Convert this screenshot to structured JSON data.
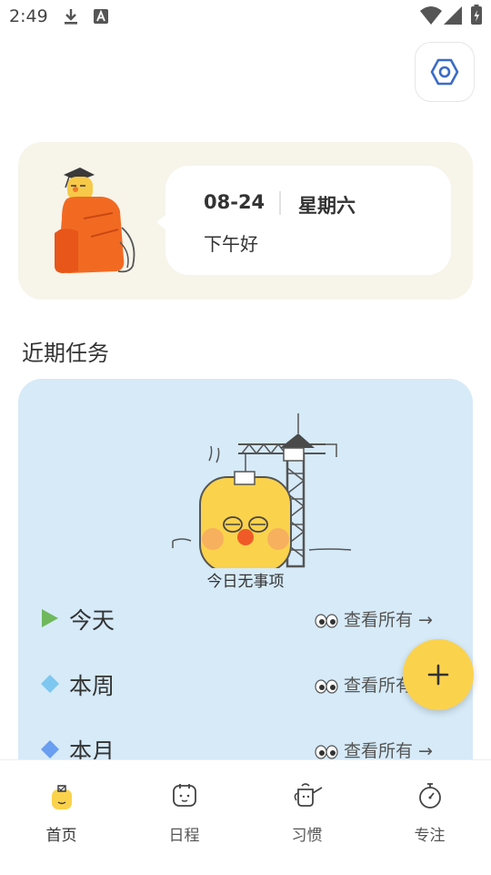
{
  "status_bar": {
    "time": "2:49"
  },
  "greeting": {
    "date": "08-24",
    "weekday": "星期六",
    "message": "下午好"
  },
  "recent_tasks": {
    "title": "近期任务",
    "empty_text": "今日无事项",
    "rows": [
      {
        "label": "今天",
        "view_all": "查看所有",
        "marker_color": "#6fb85c"
      },
      {
        "label": "本周",
        "view_all": "查看所有",
        "marker_color": "#7ec7f0"
      },
      {
        "label": "本月",
        "view_all": "查看所有",
        "marker_color": "#6a9ef0"
      }
    ]
  },
  "fab": {
    "icon": "plus-icon"
  },
  "nav": {
    "items": [
      {
        "label": "首页",
        "icon": "home-mascot-icon",
        "active": true
      },
      {
        "label": "日程",
        "icon": "calendar-icon"
      },
      {
        "label": "习惯",
        "icon": "watering-can-icon"
      },
      {
        "label": "专注",
        "icon": "stopwatch-icon"
      }
    ]
  },
  "colors": {
    "accent": "#fbd24c",
    "task_card": "#d6eaf8",
    "greeting_card": "#f7f4ea"
  }
}
